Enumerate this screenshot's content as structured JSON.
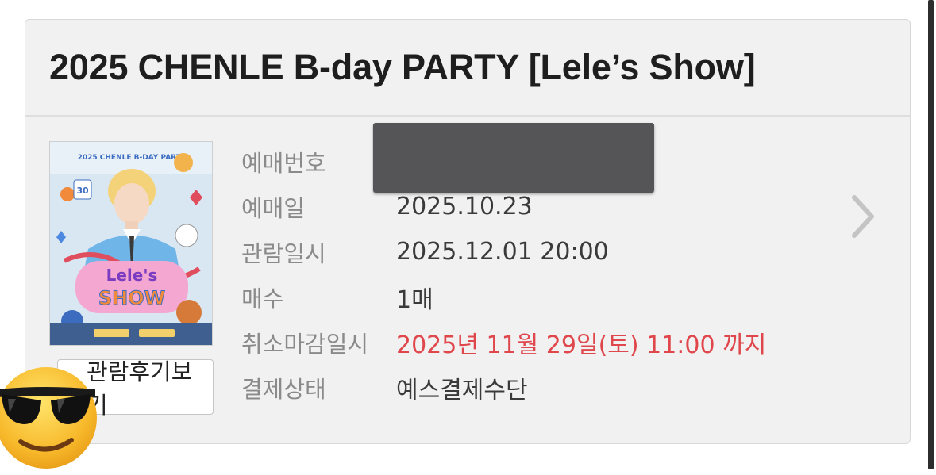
{
  "booking": {
    "title": "2025 CHENLE B-day PARTY [Lele’s Show]",
    "review_button_label": "관람후기보기",
    "fields": [
      {
        "label": "예매번호",
        "value": "",
        "redacted": true
      },
      {
        "label": "예매일",
        "value": "2025.10.23"
      },
      {
        "label": "관람일시",
        "value": "2025.12.01 20:00"
      },
      {
        "label": "매수",
        "value": "1매"
      },
      {
        "label": "취소마감일시",
        "value": "2025년 11월 29일(토) 11:00 까지",
        "highlight": true
      },
      {
        "label": "결제상태",
        "value": "예스결제수단"
      }
    ]
  },
  "poster": {
    "top_text": "2025 CHENLE B-DAY PARTY",
    "logo_line1": "Lele's",
    "logo_line2": "SHOW",
    "badge_number": "30"
  },
  "icons": {
    "chevron": "chevron-right-icon",
    "overlay": "sunglasses-emoji-icon"
  },
  "colors": {
    "alert": "#e0474c",
    "label": "#8a8a8a",
    "value": "#3a3a3a",
    "card_bg": "#f1f1f1"
  }
}
